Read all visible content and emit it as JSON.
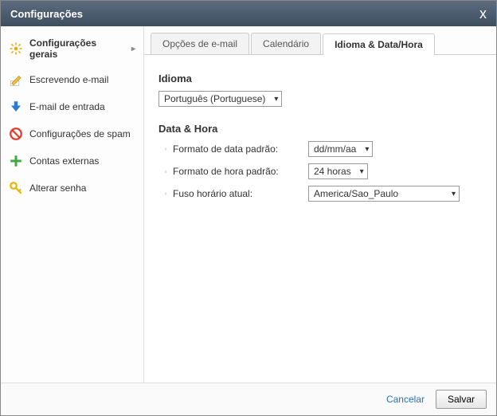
{
  "title": "Configurações",
  "sidebar": {
    "items": [
      {
        "label": "Configurações gerais"
      },
      {
        "label": "Escrevendo e-mail"
      },
      {
        "label": "E-mail de entrada"
      },
      {
        "label": "Configurações de spam"
      },
      {
        "label": "Contas externas"
      },
      {
        "label": "Alterar senha"
      }
    ]
  },
  "tabs": [
    {
      "label": "Opções de e-mail"
    },
    {
      "label": "Calendário"
    },
    {
      "label": "Idioma & Data/Hora"
    }
  ],
  "panel": {
    "languageHeading": "Idioma",
    "languageValue": "Português (Portuguese)",
    "dateTimeHeading": "Data & Hora",
    "rows": [
      {
        "label": "Formato de data padrão:",
        "value": "dd/mm/aa"
      },
      {
        "label": "Formato de hora padrão:",
        "value": "24 horas"
      },
      {
        "label": "Fuso horário atual:",
        "value": "America/Sao_Paulo"
      }
    ]
  },
  "footer": {
    "cancel": "Cancelar",
    "save": "Salvar"
  }
}
